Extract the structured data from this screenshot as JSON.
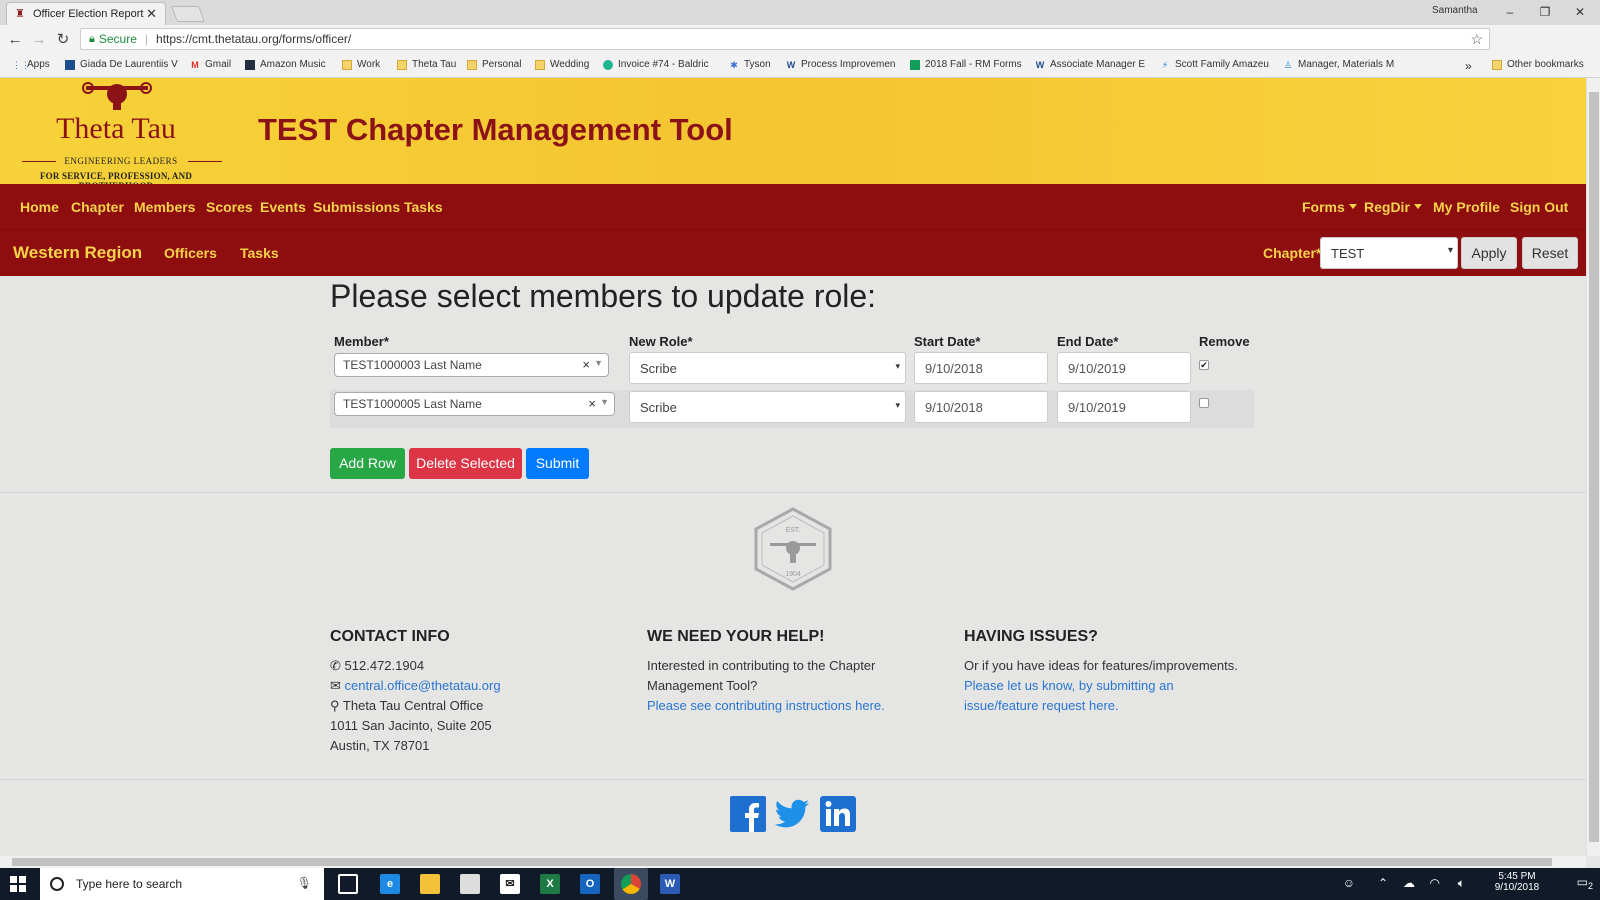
{
  "browser": {
    "tab_title": "Officer Election Report",
    "tab_close": "✕",
    "profile_name": "Samantha",
    "win_min": "–",
    "win_max": "❐",
    "win_close": "✕",
    "secure_label": "Secure",
    "url": "https://cmt.thetatau.org/forms/officer/",
    "bookmarks": [
      {
        "label": "Apps"
      },
      {
        "label": "Giada De Laurentiis V"
      },
      {
        "label": "Gmail"
      },
      {
        "label": "Amazon Music"
      },
      {
        "label": "Work"
      },
      {
        "label": "Theta Tau"
      },
      {
        "label": "Personal"
      },
      {
        "label": "Wedding"
      },
      {
        "label": "Invoice #74 - Baldric"
      },
      {
        "label": "Tyson"
      },
      {
        "label": "Process Improvemen"
      },
      {
        "label": "2018 Fall - RM Forms"
      },
      {
        "label": "Associate Manager E"
      },
      {
        "label": "Scott Family Amazeu"
      },
      {
        "label": "Manager, Materials M"
      },
      {
        "label": "»"
      },
      {
        "label": "Other bookmarks"
      }
    ]
  },
  "header": {
    "logo_name": "Theta Tau",
    "logo_line1": "ENGINEERING LEADERS",
    "logo_line2": "FOR SERVICE, PROFESSION, AND BROTHERHOOD",
    "app_title": "TEST Chapter Management Tool"
  },
  "nav": {
    "items": [
      "Home",
      "Chapter",
      "Members",
      "Scores",
      "Events",
      "Submissions",
      "Tasks"
    ],
    "forms": "Forms",
    "regdir": "RegDir",
    "profile": "My Profile",
    "signout": "Sign Out"
  },
  "subnav": {
    "region": "Western Region",
    "officers": "Officers",
    "tasks": "Tasks",
    "chapter_label": "Chapter*",
    "chapter_value": "TEST",
    "apply": "Apply",
    "reset": "Reset"
  },
  "form": {
    "heading": "Please select members to update role:",
    "columns": {
      "member": "Member*",
      "role": "New Role*",
      "start": "Start Date*",
      "end": "End Date*",
      "remove": "Remove"
    },
    "rows": [
      {
        "member": "TEST1000003 Last Name",
        "role": "Scribe",
        "start": "9/10/2018",
        "end": "9/10/2019",
        "remove_mark": "✔"
      },
      {
        "member": "TEST1000005 Last Name",
        "role": "Scribe",
        "start": "9/10/2018",
        "end": "9/10/2019",
        "remove_mark": ""
      }
    ],
    "clear_mark": "×",
    "add_row": "Add Row",
    "delete_selected": "Delete Selected",
    "submit": "Submit"
  },
  "seal": {
    "est": "EST.",
    "year": "1904"
  },
  "footer": {
    "contact_title": "CONTACT INFO",
    "phone": "512.472.1904",
    "email": "central.office@thetatau.org",
    "office": "Theta Tau Central Office",
    "address1": "1011 San Jacinto, Suite 205",
    "address2": "Austin, TX 78701",
    "help_title": "WE NEED YOUR HELP!",
    "help_text1": "Interested in contributing to the Chapter",
    "help_text2": "Management Tool?",
    "help_link": "Please see contributing instructions here.",
    "issues_title": "HAVING ISSUES?",
    "issues_text": "Or if you have ideas for features/improvements.",
    "issues_link1": "Please let us know, by submitting an",
    "issues_link2": "issue/feature request here."
  },
  "taskbar": {
    "search_placeholder": "Type here to search",
    "time": "5:45 PM",
    "date": "9/10/2018",
    "notif_count": "2"
  },
  "colors": {
    "header_gold": "#f4c531",
    "nav_red": "#8e0e10",
    "nav_text": "#f7d34a",
    "add_green": "#28a745",
    "delete_red": "#dc3545",
    "submit_blue": "#007bff",
    "link_blue": "#2a76d2"
  },
  "icons": [
    "phone-icon",
    "envelope-icon",
    "map-marker-icon",
    "facebook-icon",
    "twitter-icon",
    "linkedin-icon"
  ]
}
